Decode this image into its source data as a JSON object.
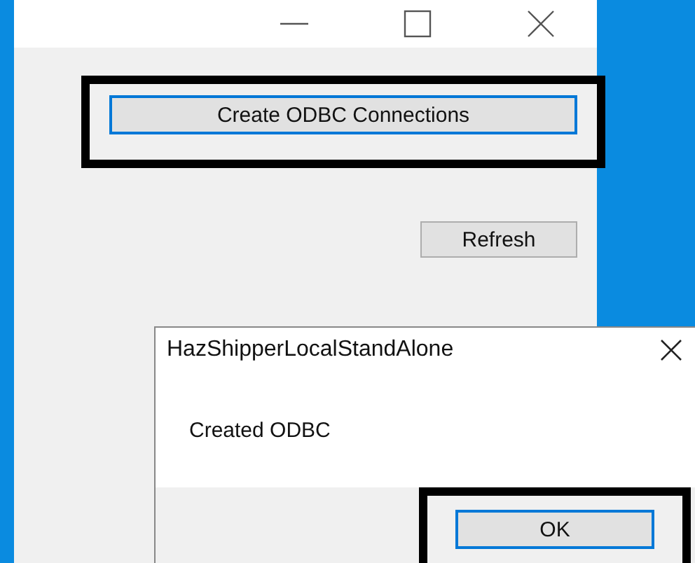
{
  "main_window": {
    "buttons": [
      {
        "label": "Create ODBC Connections",
        "focused": true,
        "highlighted": true
      },
      {
        "label": "Refresh",
        "focused": false,
        "highlighted": false
      }
    ]
  },
  "dialog": {
    "title": "HazShipperLocalStandAlone",
    "message": "Created ODBC",
    "buttons": [
      {
        "label": "OK",
        "focused": true,
        "highlighted": true
      }
    ]
  }
}
